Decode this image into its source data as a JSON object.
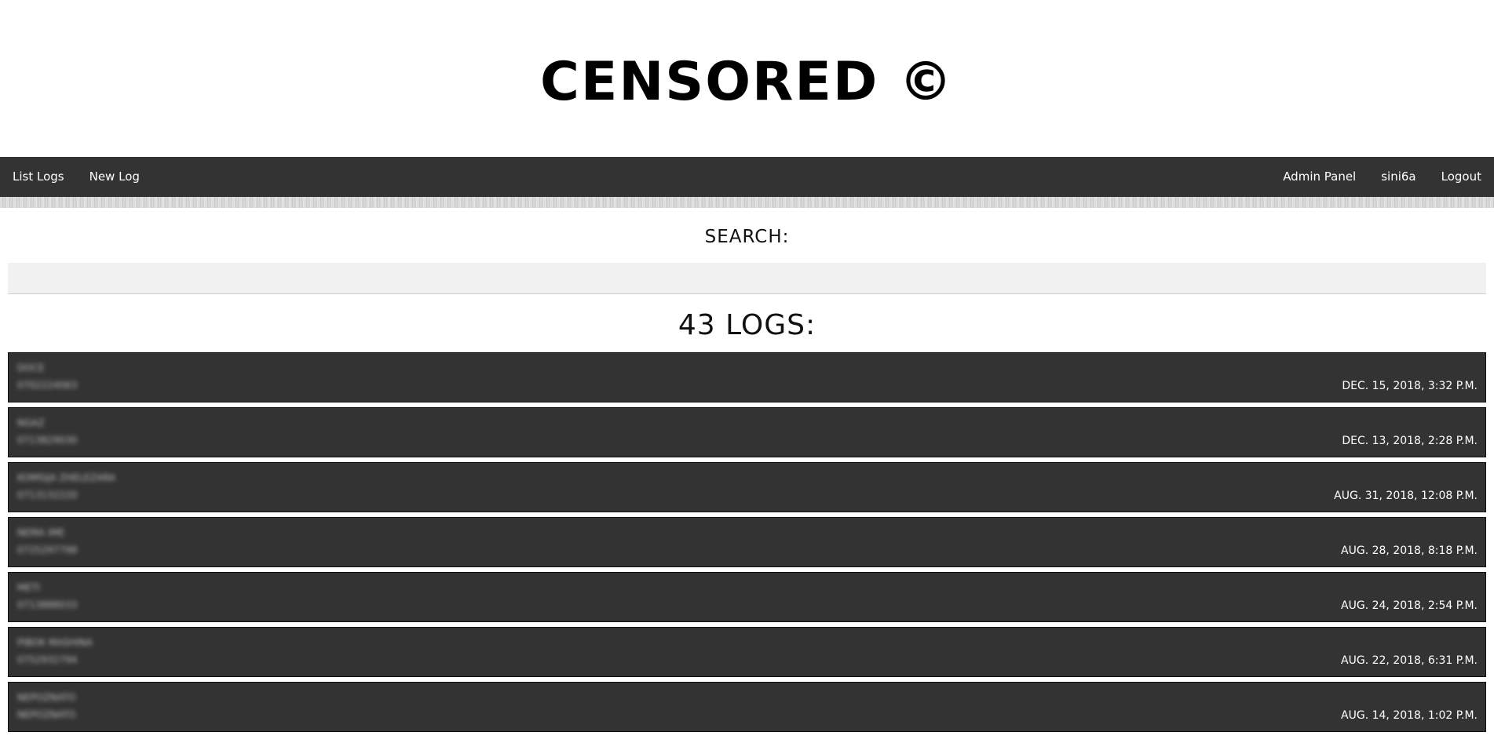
{
  "site": {
    "title": "CENSORED ©"
  },
  "nav": {
    "left": [
      "List Logs",
      "New Log"
    ],
    "right": [
      "Admin Panel",
      "sini6a",
      "Logout"
    ]
  },
  "search": {
    "label": "SEARCH:",
    "value": ""
  },
  "logs": {
    "count_label": "43 LOGS:",
    "items": [
      {
        "name": "DOCE",
        "id": "0702224063",
        "date": "DEC. 15, 2018, 3:32 P.M."
      },
      {
        "name": "NGAZ",
        "id": "0713829030",
        "date": "DEC. 13, 2018, 2:28 P.M."
      },
      {
        "name": "KOMSIJA ZHELEZARA",
        "id": "0713132220",
        "date": "AUG. 31, 2018, 12:08 P.M."
      },
      {
        "name": "NEMA IME",
        "id": "0725297798",
        "date": "AUG. 28, 2018, 8:18 P.M."
      },
      {
        "name": "METI",
        "id": "0713888033",
        "date": "AUG. 24, 2018, 2:54 P.M."
      },
      {
        "name": "PIBOK MASHINA",
        "id": "0752932794",
        "date": "AUG. 22, 2018, 6:31 P.M."
      },
      {
        "name": "NEPOZNATO",
        "id": "NEPOZNATO",
        "date": "AUG. 14, 2018, 1:02 P.M."
      }
    ]
  },
  "colors": {
    "navbar": "#333333",
    "log_item": "#333333",
    "search_bg": "#f1f1f1"
  }
}
